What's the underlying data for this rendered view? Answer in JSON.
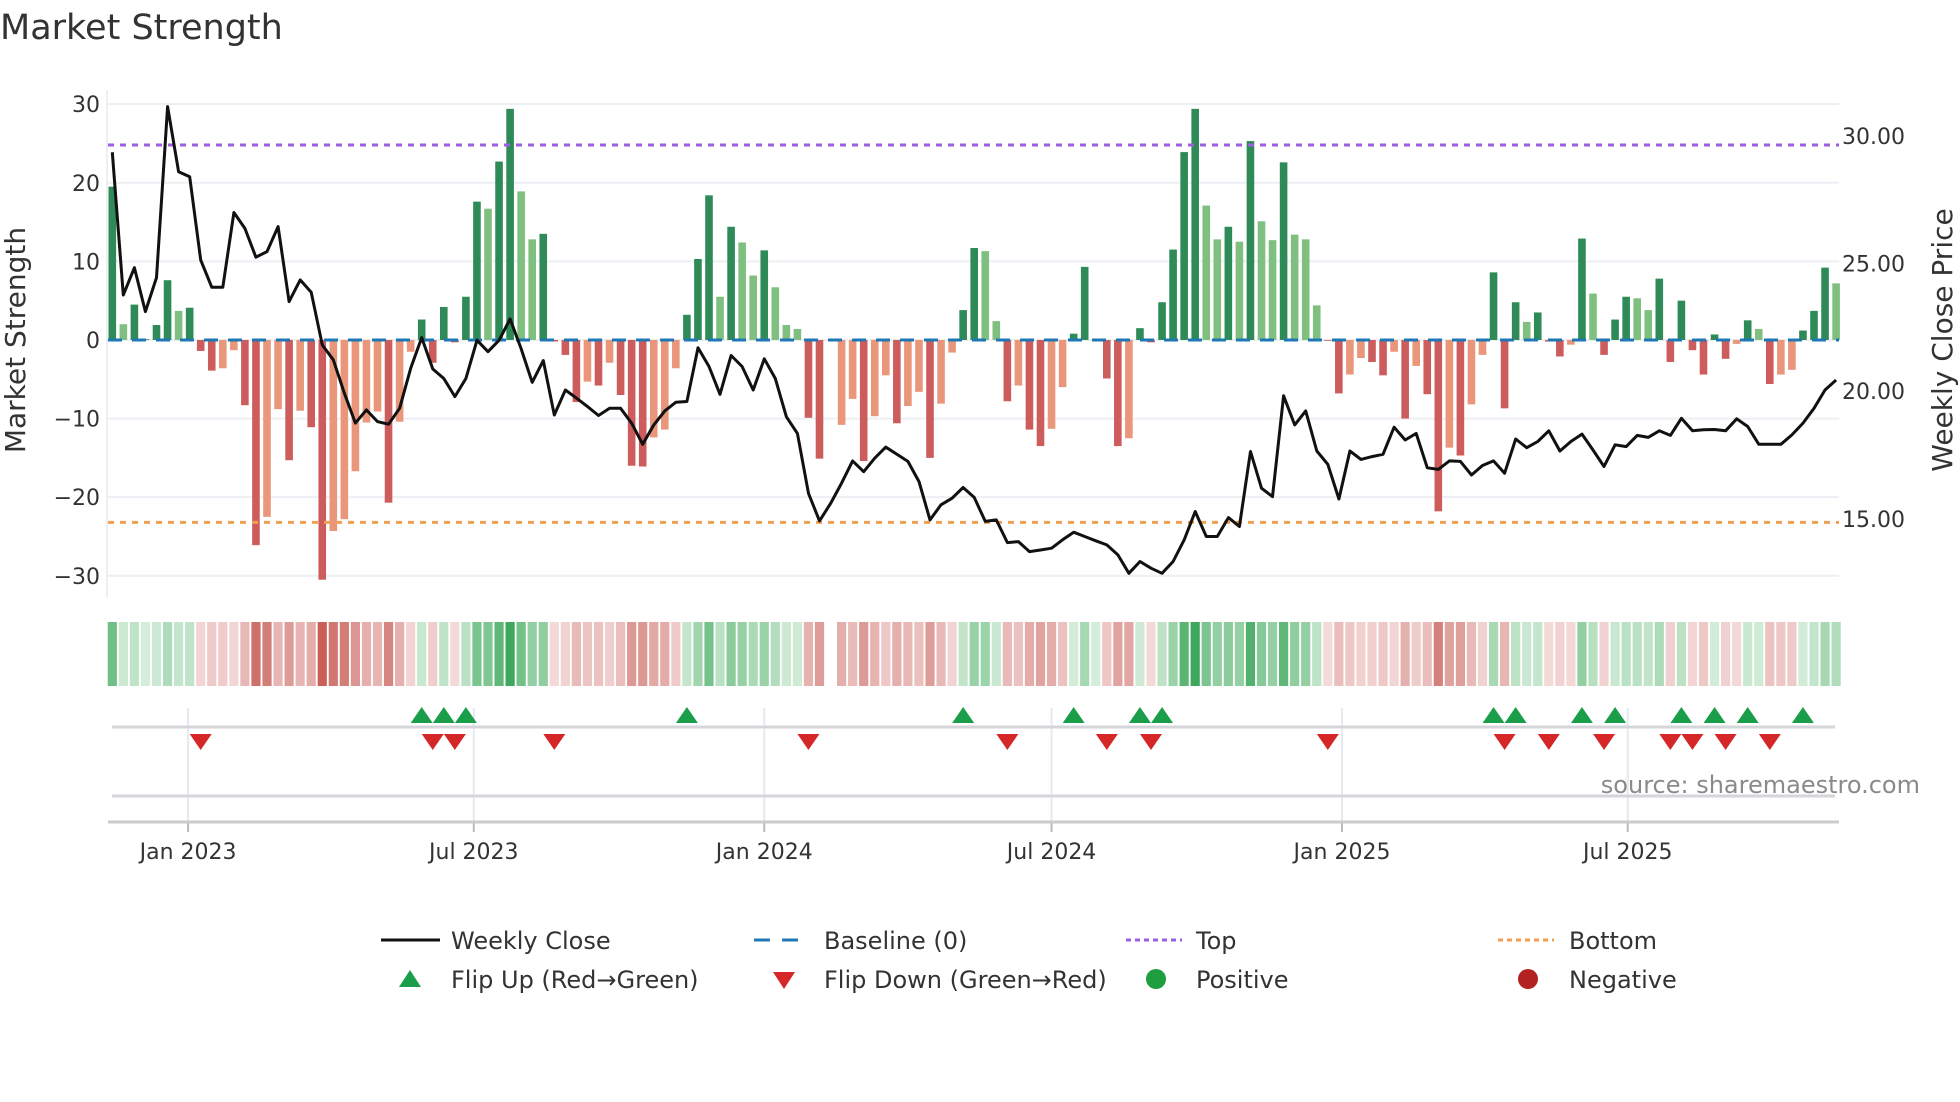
{
  "title": "Market Strength",
  "source": "source: sharemaestro.com",
  "legend": {
    "weekly_close": "Weekly Close",
    "baseline": "Baseline (0)",
    "top": "Top",
    "bottom": "Bottom",
    "flip_up": "Flip Up (Red→Green)",
    "flip_down": "Flip Down (Green→Red)",
    "positive": "Positive",
    "negative": "Negative"
  },
  "colors": {
    "bar_pos_strong": "#2e8b57",
    "bar_pos_weak": "#7fbf7f",
    "bar_neg_strong": "#cd5c5c",
    "bar_neg_weak": "#e9967a",
    "line": "#111111",
    "baseline": "#1f77b4",
    "top": "#9b5fe0",
    "bottom": "#f0a050",
    "flip_up": "#1a9e4a",
    "flip_down": "#d62728",
    "positive": "#1e9e3e",
    "negative": "#b22222",
    "grid": "#eceff3"
  },
  "chart_data": {
    "type": "bar+line",
    "title": "Market Strength",
    "start_week": "2022-11-14",
    "interval_days": 7,
    "strength": [
      19.5,
      2.0,
      4.5,
      0.1,
      1.9,
      7.6,
      3.7,
      4.1,
      -1.4,
      -3.9,
      -3.6,
      -1.3,
      -8.3,
      -26.1,
      -22.5,
      -8.8,
      -15.3,
      -9.0,
      -11.1,
      -30.5,
      -24.3,
      -22.8,
      -16.7,
      -10.5,
      -9.1,
      -20.7,
      -10.4,
      -1.5,
      2.6,
      -2.9,
      4.2,
      -0.3,
      5.5,
      17.6,
      16.7,
      22.7,
      29.4,
      18.9,
      12.8,
      13.5,
      -0.2,
      -1.9,
      -7.9,
      -5.3,
      -5.8,
      -2.9,
      -7.0,
      -16.0,
      -16.1,
      -12.4,
      -11.4,
      -3.6,
      3.2,
      10.3,
      18.4,
      5.5,
      14.4,
      12.4,
      8.2,
      11.4,
      6.7,
      1.9,
      1.4,
      -9.9,
      -15.1,
      null,
      -10.8,
      -7.5,
      -15.4,
      -9.7,
      -4.5,
      -10.6,
      -8.4,
      -6.6,
      -15.0,
      -8.1,
      -1.6,
      3.8,
      11.7,
      11.3,
      2.4,
      -7.8,
      -5.8,
      -11.4,
      -13.5,
      -11.3,
      -6.0,
      0.8,
      9.3,
      0.1,
      -4.9,
      -13.5,
      -12.5,
      1.5,
      -0.3,
      4.8,
      11.5,
      23.9,
      29.4,
      17.1,
      12.8,
      14.4,
      12.5,
      25.3,
      15.1,
      12.7,
      22.6,
      13.4,
      12.8,
      4.4,
      -0.1,
      -6.8,
      -4.4,
      -2.3,
      -2.8,
      -4.5,
      -1.5,
      -10.0,
      -3.3,
      -6.9,
      -21.8,
      -13.7,
      -14.7,
      -8.2,
      -1.9,
      8.6,
      -8.7,
      4.8,
      2.3,
      3.5,
      -0.2,
      -2.1,
      -0.6,
      12.9,
      5.9,
      -1.9,
      2.6,
      5.5,
      5.3,
      3.8,
      7.8,
      -2.8,
      5.0,
      -1.3,
      -4.4,
      0.7,
      -2.4,
      -0.5,
      2.5,
      1.4,
      -5.6,
      -4.4,
      -3.8,
      1.2,
      3.7,
      9.2,
      7.2
    ],
    "strength_shade_codes": "DLDDDDLDDDLLDDLLDLDDLLLLLDLLDDDDDDLDDLLDDDDLDLDDDLLLDDDLDLLDLLLDDDLLDLLDLLDLLDDLLDLDDLLDDDDDLDDDDDDLLDLDLLDLLLDDLLDDLDLDDLDLLDDDLDDDLDLDDDLLDDDDDDDLDLDLLDDDL",
    "close": [
      29.36,
      23.77,
      24.84,
      23.12,
      24.45,
      31.15,
      28.6,
      28.4,
      25.14,
      24.07,
      24.07,
      27.0,
      26.38,
      25.25,
      25.47,
      26.45,
      23.51,
      24.36,
      23.88,
      21.81,
      21.23,
      19.92,
      18.75,
      19.27,
      18.81,
      18.71,
      19.33,
      20.9,
      22.1,
      20.87,
      20.5,
      19.79,
      20.5,
      22.0,
      21.55,
      22.0,
      22.83,
      21.67,
      20.35,
      21.2,
      19.07,
      20.05,
      19.73,
      19.4,
      19.05,
      19.33,
      19.33,
      18.75,
      17.92,
      18.68,
      19.23,
      19.57,
      19.6,
      21.7,
      20.97,
      19.88,
      21.4,
      20.97,
      20.05,
      21.27,
      20.5,
      19.0,
      18.35,
      16.0,
      14.92,
      15.6,
      16.4,
      17.27,
      16.85,
      17.38,
      17.81,
      17.53,
      17.25,
      16.46,
      14.96,
      15.55,
      15.81,
      16.23,
      15.84,
      14.9,
      14.96,
      14.07,
      14.11,
      13.72,
      13.78,
      13.85,
      14.18,
      14.48,
      14.31,
      14.14,
      13.98,
      13.59,
      12.87,
      13.33,
      13.07,
      12.87,
      13.33,
      14.18,
      15.29,
      14.31,
      14.31,
      15.05,
      14.7,
      17.64,
      16.2,
      15.87,
      19.82,
      18.68,
      19.23,
      17.66,
      17.14,
      15.78,
      17.66,
      17.33,
      17.44,
      17.53,
      18.59,
      18.09,
      18.35,
      17.0,
      16.94,
      17.27,
      17.25,
      16.72,
      17.09,
      17.27,
      16.79,
      18.13,
      17.79,
      18.03,
      18.45,
      17.66,
      18.03,
      18.32,
      17.7,
      17.05,
      17.9,
      17.83,
      18.27,
      18.19,
      18.45,
      18.27,
      18.94,
      18.45,
      18.49,
      18.5,
      18.45,
      18.92,
      18.62,
      17.92,
      17.92,
      17.92,
      18.29,
      18.75,
      19.33,
      20.05,
      20.44
    ],
    "top": 24.8,
    "bottom": -23.2,
    "baseline": 0,
    "flip_up_weeks": [
      29,
      31,
      33,
      53,
      78,
      88,
      94,
      96,
      126,
      128,
      134,
      137,
      143,
      146,
      149,
      154
    ],
    "flip_down_weeks": [
      9,
      30,
      32,
      41,
      64,
      82,
      91,
      95,
      111,
      127,
      131,
      136,
      142,
      144,
      147,
      151
    ],
    "y_left": {
      "label": "Market Strength",
      "ticks": [
        30,
        20,
        10,
        0,
        -10,
        -20,
        -30
      ],
      "tick_labels": [
        "30",
        "20",
        "10",
        "0",
        "−10",
        "−20",
        "−30"
      ],
      "ylim": [
        -32.7,
        31.8
      ]
    },
    "y_right": {
      "label": "Weekly Close Price",
      "ticks": [
        30,
        25,
        20,
        15
      ],
      "tick_labels": [
        "30.00",
        "25.00",
        "20.00",
        "15.00"
      ],
      "ylim": [
        11.94,
        31.8
      ]
    },
    "x_ticks": [
      {
        "label": "Jan 2023",
        "date": "2023-01-01"
      },
      {
        "label": "Jul 2023",
        "date": "2023-07-01"
      },
      {
        "label": "Jan 2024",
        "date": "2024-01-01"
      },
      {
        "label": "Jul 2024",
        "date": "2024-07-01"
      },
      {
        "label": "Jan 2025",
        "date": "2025-01-01"
      },
      {
        "label": "Jul 2025",
        "date": "2025-07-01"
      }
    ],
    "grid": true,
    "legend_position": "bottom"
  }
}
